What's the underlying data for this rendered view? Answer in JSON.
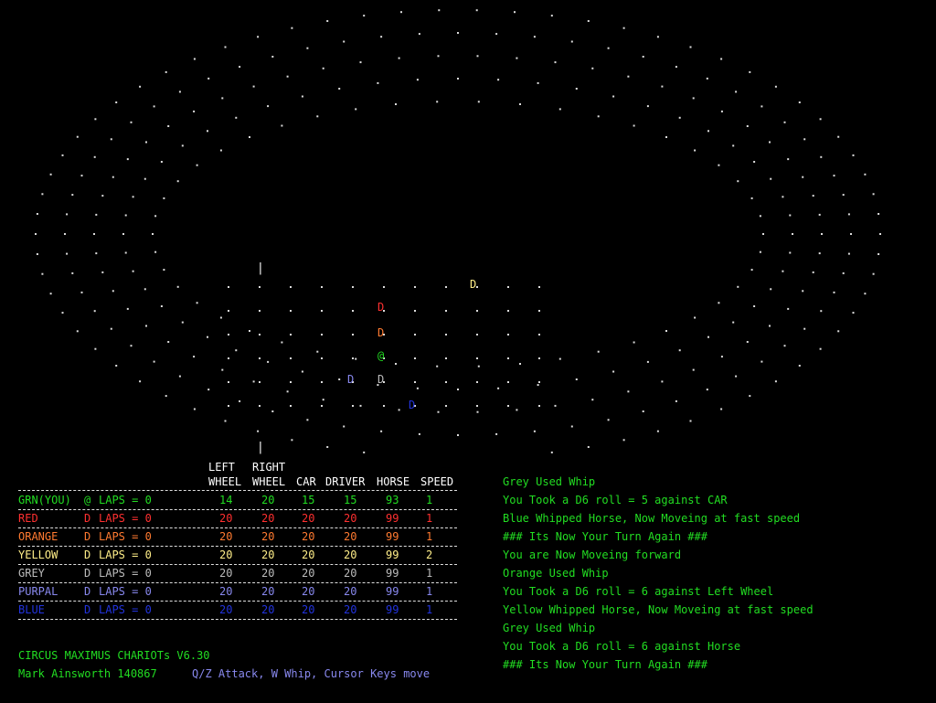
{
  "colors": {
    "green": "#22dd22",
    "red": "#ff3030",
    "orange": "#ff7a30",
    "yellow": "#ffee88",
    "grey": "#bbbbbb",
    "purpal": "#8888ee",
    "blue": "#2233dd",
    "white": "#ffffff"
  },
  "track": {
    "car_glyph": "D",
    "player_glyph": "@",
    "marker_glyph": "|"
  },
  "table": {
    "headers_top": [
      "LEFT",
      "RIGHT"
    ],
    "headers_bottom": [
      "WHEEL",
      "WHEEL",
      "CAR",
      "DRIVER",
      "HORSE",
      "SPEED"
    ],
    "rows": [
      {
        "name": "GRN(YOU)",
        "glyph": "@",
        "laps": "LAPS = 0",
        "values": [
          "14",
          "20",
          "15",
          "15",
          "93",
          "1"
        ],
        "color": "green"
      },
      {
        "name": "RED",
        "glyph": "D",
        "laps": "LAPS = 0",
        "values": [
          "20",
          "20",
          "20",
          "20",
          "99",
          "1"
        ],
        "color": "red"
      },
      {
        "name": "ORANGE",
        "glyph": "D",
        "laps": "LAPS = 0",
        "values": [
          "20",
          "20",
          "20",
          "20",
          "99",
          "1"
        ],
        "color": "orange"
      },
      {
        "name": "YELLOW",
        "glyph": "D",
        "laps": "LAPS = 0",
        "values": [
          "20",
          "20",
          "20",
          "20",
          "99",
          "2"
        ],
        "color": "yellow"
      },
      {
        "name": "GREY",
        "glyph": "D",
        "laps": "LAPS = 0",
        "values": [
          "20",
          "20",
          "20",
          "20",
          "99",
          "1"
        ],
        "color": "grey"
      },
      {
        "name": "PURPAL",
        "glyph": "D",
        "laps": "LAPS = 0",
        "values": [
          "20",
          "20",
          "20",
          "20",
          "99",
          "1"
        ],
        "color": "purpal"
      },
      {
        "name": "BLUE",
        "glyph": "D",
        "laps": "LAPS = 0",
        "values": [
          "20",
          "20",
          "20",
          "20",
          "99",
          "1"
        ],
        "color": "blue"
      }
    ]
  },
  "log": [
    "Grey Used Whip",
    "You Took a D6 roll = 5 against CAR",
    "Blue Whipped Horse, Now Moveing at fast speed",
    "### Its Now Your Turn Again ###",
    "You are Now Moveing forward",
    "Orange Used Whip",
    "You Took a D6 roll = 6 against Left Wheel",
    "Yellow Whipped Horse, Now Moveing at fast speed",
    "Grey Used Whip",
    "You Took a D6 roll = 6 against Horse",
    "### Its Now Your Turn Again ###"
  ],
  "footer": {
    "title": "CIRCUS MAXIMUS CHARIOTs V6.30",
    "author": "Mark Ainsworth 140867",
    "controls": "Q/Z Attack, W Whip, Cursor Keys move"
  }
}
